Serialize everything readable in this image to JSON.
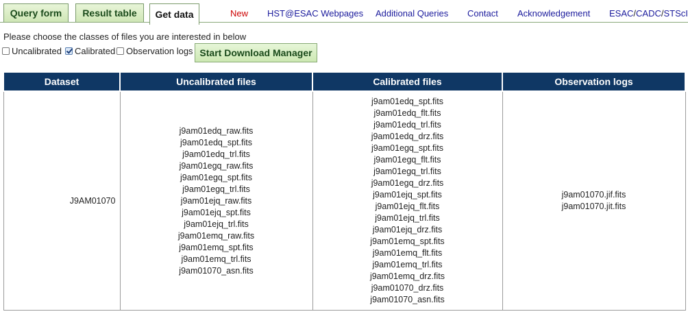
{
  "nav": {
    "tabs": [
      {
        "label": "Query form"
      },
      {
        "label": "Result table"
      },
      {
        "label": "Get data"
      }
    ],
    "links": [
      {
        "label": "New"
      },
      {
        "label": "HST@ESAC Webpages"
      },
      {
        "label": "Additional Queries"
      },
      {
        "label": "Contact"
      },
      {
        "label": "Acknowledgement"
      }
    ],
    "partners": {
      "esac": "ESAC",
      "sep1": "/",
      "cadc": "CADC",
      "sep2": "/",
      "stsci": "STScI"
    }
  },
  "chooser": {
    "prompt": "Please choose the classes of files you are interested in below",
    "options": [
      {
        "label": "Uncalibrated",
        "checked": false
      },
      {
        "label": "Calibrated",
        "checked": true
      },
      {
        "label": "Observation logs",
        "checked": false
      }
    ],
    "download_button": "Start Download Manager"
  },
  "table": {
    "headers": [
      "Dataset",
      "Uncalibrated files",
      "Calibrated files",
      "Observation logs"
    ],
    "rows": [
      {
        "dataset": "J9AM01070",
        "uncalibrated": [
          "j9am01edq_raw.fits",
          "j9am01edq_spt.fits",
          "j9am01edq_trl.fits",
          "j9am01egq_raw.fits",
          "j9am01egq_spt.fits",
          "j9am01egq_trl.fits",
          "j9am01ejq_raw.fits",
          "j9am01ejq_spt.fits",
          "j9am01ejq_trl.fits",
          "j9am01emq_raw.fits",
          "j9am01emq_spt.fits",
          "j9am01emq_trl.fits",
          "j9am01070_asn.fits"
        ],
        "calibrated": [
          "j9am01edq_spt.fits",
          "j9am01edq_flt.fits",
          "j9am01edq_trl.fits",
          "j9am01edq_drz.fits",
          "j9am01egq_spt.fits",
          "j9am01egq_flt.fits",
          "j9am01egq_trl.fits",
          "j9am01egq_drz.fits",
          "j9am01ejq_spt.fits",
          "j9am01ejq_flt.fits",
          "j9am01ejq_trl.fits",
          "j9am01ejq_drz.fits",
          "j9am01emq_spt.fits",
          "j9am01emq_flt.fits",
          "j9am01emq_trl.fits",
          "j9am01emq_drz.fits",
          "j9am01070_drz.fits",
          "j9am01070_asn.fits"
        ],
        "logs": [
          "j9am01070.jif.fits",
          "j9am01070.jit.fits"
        ]
      }
    ]
  }
}
